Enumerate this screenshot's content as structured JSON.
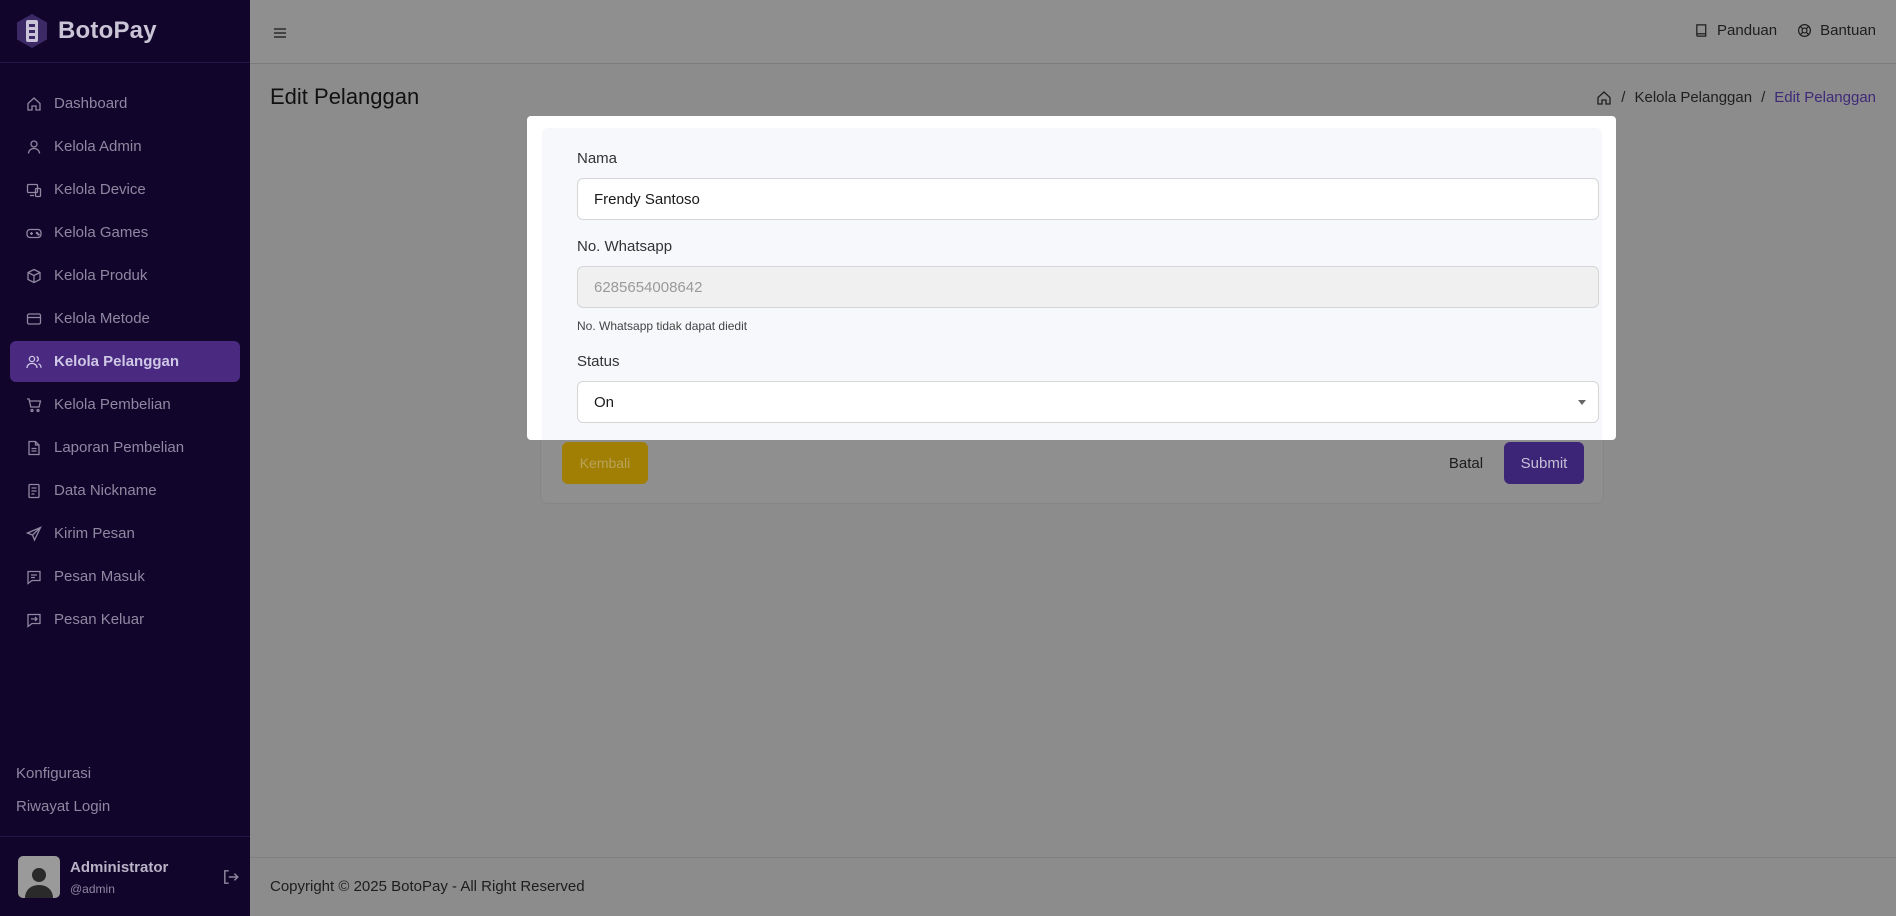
{
  "brand": {
    "name": "BotoPay"
  },
  "sidebar": {
    "items": [
      {
        "label": "Dashboard",
        "icon": "home-icon"
      },
      {
        "label": "Kelola Admin",
        "icon": "user-icon"
      },
      {
        "label": "Kelola Device",
        "icon": "devices-icon"
      },
      {
        "label": "Kelola Games",
        "icon": "gamepad-icon"
      },
      {
        "label": "Kelola Produk",
        "icon": "box-icon"
      },
      {
        "label": "Kelola Metode",
        "icon": "credit-card-icon"
      },
      {
        "label": "Kelola Pelanggan",
        "icon": "users-icon",
        "active": true
      },
      {
        "label": "Kelola Pembelian",
        "icon": "cart-icon"
      },
      {
        "label": "Laporan Pembelian",
        "icon": "document-icon"
      },
      {
        "label": "Data Nickname",
        "icon": "list-document-icon"
      },
      {
        "label": "Kirim Pesan",
        "icon": "send-icon"
      },
      {
        "label": "Pesan Masuk",
        "icon": "message-icon"
      },
      {
        "label": "Pesan Keluar",
        "icon": "message-out-icon"
      }
    ],
    "footer_links": [
      "Konfigurasi",
      "Riwayat Login"
    ],
    "user": {
      "name": "Administrator",
      "handle": "@admin"
    }
  },
  "header": {
    "links": [
      {
        "label": "Panduan",
        "icon": "book-icon"
      },
      {
        "label": "Bantuan",
        "icon": "lifebuoy-icon"
      }
    ]
  },
  "page": {
    "title": "Edit Pelanggan",
    "breadcrumb": [
      "Kelola Pelanggan",
      "Edit Pelanggan"
    ]
  },
  "form": {
    "name_label": "Nama",
    "name_value": "Frendy Santoso",
    "whatsapp_label": "No. Whatsapp",
    "whatsapp_value": "6285654008642",
    "whatsapp_hint": "No. Whatsapp tidak dapat diedit",
    "status_label": "Status",
    "status_value": "On",
    "back_label": "Kembali",
    "cancel_label": "Batal",
    "submit_label": "Submit"
  },
  "footer": {
    "copyright": "Copyright © 2025 BotoPay - All Right Reserved"
  },
  "colors": {
    "sidebar_bg": "#12052b",
    "active_item": "#4a2a80",
    "submit": "#3c2476",
    "back": "#a17f05"
  }
}
